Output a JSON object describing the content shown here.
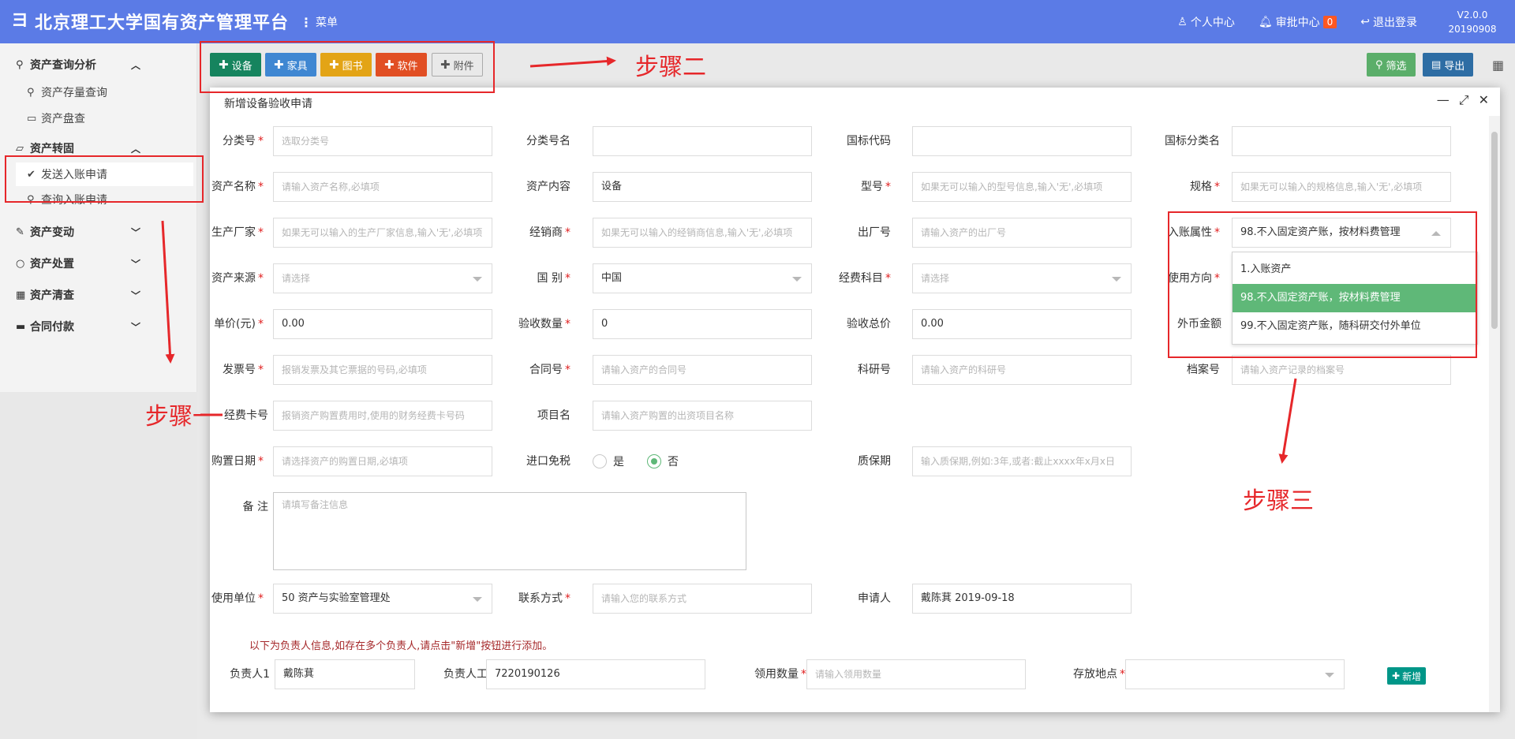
{
  "header": {
    "title": "北京理工大学国有资产管理平台",
    "menu_label": "菜单",
    "personal_center": "个人中心",
    "approval_center": "审批中心",
    "approval_count": "0",
    "logout": "退出登录",
    "version": "V2.0.0",
    "build": "20190908"
  },
  "sidebar": {
    "group_query": "资产查询分析",
    "sub_stock": "资产存量查询",
    "sub_inventory": "资产盘查",
    "group_transfer": "资产转固",
    "sub_send": "发送入账申请",
    "sub_query_apply": "查询入账申请",
    "group_change": "资产变动",
    "group_dispose": "资产处置",
    "group_clear": "资产清查",
    "group_contract": "合同付款"
  },
  "toolbar": {
    "btn_equipment": "设备",
    "btn_furniture": "家具",
    "btn_books": "图书",
    "btn_software": "软件",
    "btn_attachment": "附件",
    "btn_filter": "筛选",
    "btn_export": "导出"
  },
  "modal": {
    "title": "新增设备验收申请",
    "labels": {
      "class_no": "分类号",
      "class_name": "分类号名",
      "std_code": "国标代码",
      "std_class_name": "国标分类名",
      "asset_name": "资产名称",
      "asset_content": "资产内容",
      "model": "型号",
      "spec": "规格",
      "manufacturer": "生产厂家",
      "dealer": "经销商",
      "serial_no": "出厂号",
      "entry_attr": "入账属性",
      "source": "资产来源",
      "country": "国 别",
      "fund_subject": "经费科目",
      "usage": "使用方向",
      "unit_price": "单价(元)",
      "accept_qty": "验收数量",
      "accept_total": "验收总价",
      "foreign_amount": "外币金额",
      "invoice_no": "发票号",
      "contract_no": "合同号",
      "research_no": "科研号",
      "archive_no": "档案号",
      "fund_card": "经费卡号",
      "project_name": "项目名",
      "purchase_date": "购置日期",
      "import_tax": "进口免税",
      "warranty": "质保期",
      "remark": "备 注",
      "using_unit": "使用单位",
      "contact": "联系方式",
      "applicant": "申请人",
      "owner1": "负责人1",
      "owner_id": "负责人工号",
      "receive_qty": "领用数量",
      "location": "存放地点"
    },
    "placeholders": {
      "class_no": "选取分类号",
      "asset_name": "请输入资产名称,必填项",
      "model": "如果无可以输入的型号信息,输入'无',必填项",
      "spec": "如果无可以输入的规格信息,输入'无',必填项",
      "manufacturer": "如果无可以输入的生产厂家信息,输入'无',必填项",
      "dealer": "如果无可以输入的经销商信息,输入'无',必填项",
      "serial_no": "请输入资产的出厂号",
      "source": "请选择",
      "fund_subject": "请选择",
      "invoice_no": "报销发票及其它票据的号码,必填项",
      "contract_no": "请输入资产的合同号",
      "research_no": "请输入资产的科研号",
      "archive_no": "请输入资产记录的档案号",
      "fund_card": "报销资产购置费用时,使用的财务经费卡号码",
      "project_name": "请输入资产购置的出资项目名称",
      "purchase_date": "请选择资产的购置日期,必填项",
      "warranty": "输入质保期,例如:3年,或者:截止xxxx年x月x日",
      "remark": "请填写备注信息",
      "contact": "请输入您的联系方式",
      "receive_qty": "请输入领用数量"
    },
    "values": {
      "asset_content": "设备",
      "entry_attr": "98.不入固定资产账，按材料费管理",
      "country": "中国",
      "unit_price": "0.00",
      "accept_qty": "0",
      "accept_total": "0.00",
      "using_unit": "50 资产与实验室管理处",
      "applicant": "戴陈萁 2019-09-18",
      "owner1": "戴陈萁",
      "owner_id": "7220190126"
    },
    "radio_yes": "是",
    "radio_no": "否",
    "radio_selected": "否",
    "dropdown_options": [
      "1.入账资产",
      "98.不入固定资产账，按材料费管理",
      "99.不入固定资产账，随科研交付外单位"
    ],
    "dropdown_selected_index": 1,
    "notice": "以下为负责人信息,如存在多个负责人,请点击\"新增\"按钮进行添加。",
    "add_button": "新增"
  },
  "annotations": {
    "step1": "步骤一",
    "step2": "步骤二",
    "step3": "步骤三"
  },
  "colors": {
    "header_bg": "#5b7be6",
    "btn_equipment": "#16845e",
    "btn_furniture": "#3f87d2",
    "btn_books": "#e3a416",
    "btn_software": "#e14f24",
    "btn_attachment": "#e9e9e9",
    "btn_filter": "#5bae6a",
    "btn_export": "#2e6da4",
    "selected_option": "#5fb878",
    "annotation_red": "#e6272a"
  }
}
